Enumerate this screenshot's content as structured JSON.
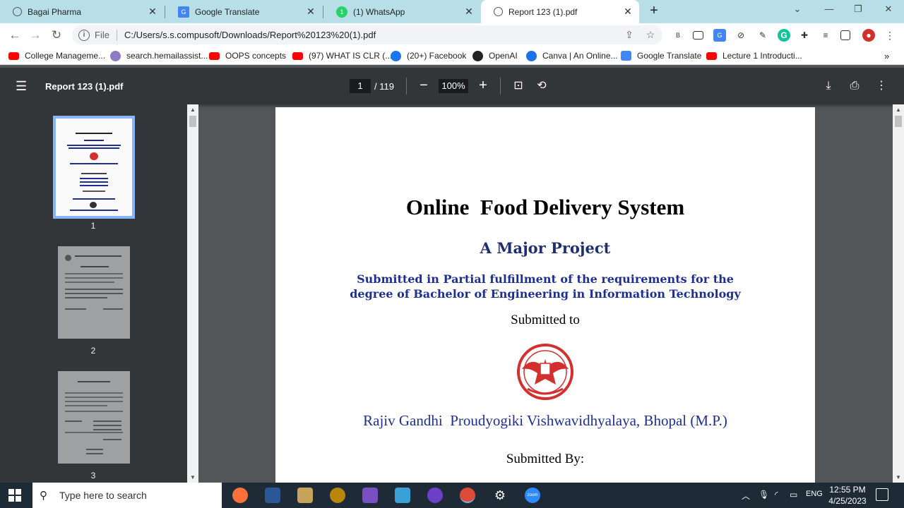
{
  "tabs": [
    {
      "label": "Bagai Pharma",
      "icon": "globe-icon"
    },
    {
      "label": "Google Translate",
      "icon": "google-translate-icon"
    },
    {
      "label": "(1) WhatsApp",
      "icon": "whatsapp-icon"
    },
    {
      "label": "Report 123 (1).pdf",
      "icon": "globe-icon",
      "active": true
    }
  ],
  "toolbar": {
    "file_label": "File",
    "url": "C:/Users/s.s.compusoft/Downloads/Report%20123%20(1).pdf"
  },
  "bookmarks": [
    {
      "label": "College Manageme...",
      "icon": "youtube-icon",
      "color": "#ff0000"
    },
    {
      "label": "search.hemailassist...",
      "icon": "globe-icon",
      "color": "#8e7cc3"
    },
    {
      "label": "OOPS concepts",
      "icon": "youtube-icon",
      "color": "#ff0000"
    },
    {
      "label": "(97) WHAT IS CLR (...",
      "icon": "youtube-icon",
      "color": "#ff0000"
    },
    {
      "label": "(20+) Facebook",
      "icon": "facebook-icon",
      "color": "#1877f2"
    },
    {
      "label": "OpenAI",
      "icon": "openai-icon",
      "color": "#222222"
    },
    {
      "label": "Canva | An Online...",
      "icon": "canva-icon",
      "color": "#1a73e8"
    },
    {
      "label": "Google Translate",
      "icon": "google-translate-icon",
      "color": "#4285f4"
    },
    {
      "label": "Lecture 1 Introducti...",
      "icon": "youtube-icon",
      "color": "#ff0000"
    }
  ],
  "pdf": {
    "title": "Report 123 (1).pdf",
    "current_page": "1",
    "total_pages": "/ 119",
    "zoom": "100%",
    "thumbnails": [
      "1",
      "2",
      "3"
    ],
    "page": {
      "title": "Online  Food Delivery System",
      "subtitle": "A Major Project",
      "fulfillment_line1": "Submitted in Partial fulfillment of the requirements for the",
      "fulfillment_line2": "degree of Bachelor of Engineering in Information Technology",
      "submitted_to": "Submitted to",
      "university": "Rajiv Gandhi  Proudyogiki Vishwavidhyalaya, Bhopal (M.P.)",
      "submitted_by": "Submitted By:"
    }
  },
  "taskbar": {
    "search_placeholder": "Type here to search",
    "language": "ENG",
    "time": "12:55 PM",
    "date": "4/25/2023"
  }
}
